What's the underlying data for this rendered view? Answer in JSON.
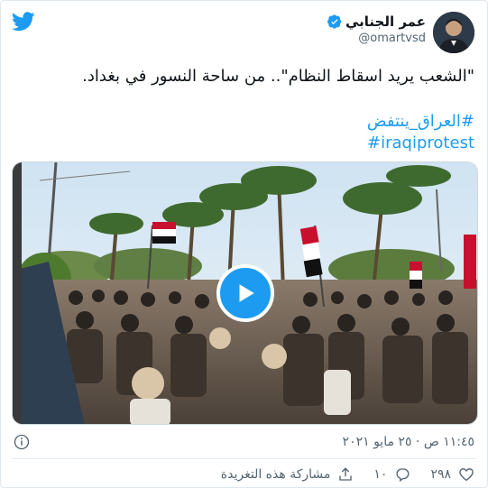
{
  "tweet": {
    "author_name": "عمر الجنابي",
    "author_handle": "@omartvsd",
    "text": "\"الشعب يريد اسقاط النظام\".. من ساحة النسور في بغداد.",
    "hashtags": [
      "#العراق_ينتفض",
      "#iraqiprotest"
    ],
    "datetime": "١١:٤٥ ص · ٢٥ مايو ٢٠٢١",
    "likes": "٢٩٨",
    "replies": "١٠",
    "share_label": "مشاركة هذه التغريدة"
  },
  "colors": {
    "brand": "#1d9bf0",
    "text": "#0f1419",
    "muted": "#536471"
  },
  "icons": [
    "twitter-bird-icon",
    "verified-badge-icon",
    "play-icon",
    "info-icon",
    "heart-icon",
    "reply-icon",
    "share-icon"
  ]
}
